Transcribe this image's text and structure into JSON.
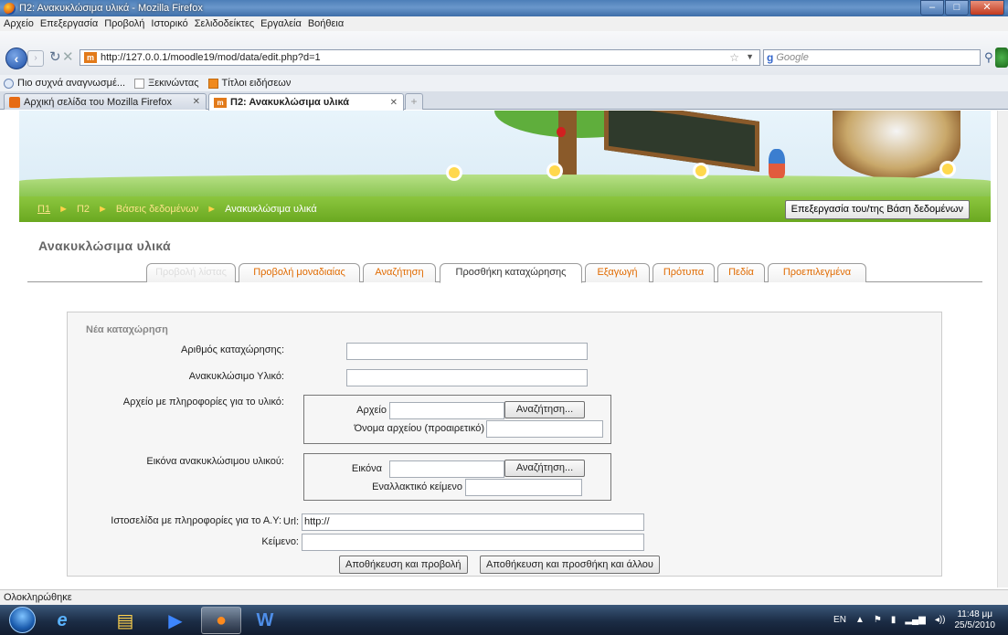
{
  "window": {
    "title": "Π2: Ανακυκλώσιμα υλικά - Mozilla Firefox",
    "controls": {
      "minimize": "–",
      "maximize": "□",
      "close": "✕"
    }
  },
  "menubar": [
    "Αρχείο",
    "Επεξεργασία",
    "Προβολή",
    "Ιστορικό",
    "Σελιδοδείκτες",
    "Εργαλεία",
    "Βοήθεια"
  ],
  "navbar": {
    "url": "http://127.0.0.1/moodle19/mod/data/edit.php?d=1",
    "search_placeholder": "Google",
    "search_engine": "g"
  },
  "bookmarks": [
    "Πιο συχνά αναγνωσμέ...",
    "Ξεκινώντας",
    "Τίτλοι ειδήσεων"
  ],
  "tabs": [
    {
      "label": "Αρχική σελίδα του Mozilla Firefox",
      "active": false
    },
    {
      "label": "Π2: Ανακυκλώσιμα υλικά",
      "active": true
    }
  ],
  "breadcrumb": {
    "items": [
      "Π1",
      "Π2",
      "Βάσεις δεδομένων"
    ],
    "current": "Ανακυκλώσιμα υλικά",
    "separator": "►"
  },
  "edit_db_button": "Επεξεργασία του/της Βάση δεδομένων",
  "page_title": "Ανακυκλώσιμα υλικά",
  "db_tabs": [
    {
      "label": "Προβολή λίστας",
      "selected": false,
      "faded": true
    },
    {
      "label": "Προβολή μοναδιαίας",
      "selected": false,
      "faded": false
    },
    {
      "label": "Αναζήτηση",
      "selected": false,
      "faded": false
    },
    {
      "label": "Προσθήκη καταχώρησης",
      "selected": true,
      "faded": false
    },
    {
      "label": "Εξαγωγή",
      "selected": false,
      "faded": false
    },
    {
      "label": "Πρότυπα",
      "selected": false,
      "faded": false
    },
    {
      "label": "Πεδία",
      "selected": false,
      "faded": false
    },
    {
      "label": "Προεπιλεγμένα",
      "selected": false,
      "faded": false
    }
  ],
  "form": {
    "legend": "Νέα καταχώρηση",
    "fields": {
      "entry_number": {
        "label": "Αριθμός καταχώρησης:",
        "value": ""
      },
      "recyclable": {
        "label": "Ανακυκλώσιμο Υλικό:",
        "value": ""
      },
      "file_info": {
        "label": "Αρχείο με πληροφορίες για το υλικό:",
        "file_label": "Αρχείο",
        "filename_label": "Όνομα αρχείου (προαιρετικό)",
        "browse": "Αναζήτηση..."
      },
      "image": {
        "label": "Εικόνα ανακυκλώσιμου υλικού:",
        "image_label": "Εικόνα",
        "alt_label": "Εναλλακτικό κείμενο",
        "browse": "Αναζήτηση..."
      },
      "website": {
        "label": "Ιστοσελίδα με πληροφορίες για το Α.Υ:",
        "url_label": "Url:",
        "url_value": "http://",
        "text_label": "Κείμενο:",
        "text_value": ""
      }
    },
    "buttons": {
      "save_view": "Αποθήκευση και προβολή",
      "save_add": "Αποθήκευση και προσθήκη και άλλου"
    }
  },
  "status": "Ολοκληρώθηκε",
  "taskbar": {
    "language": "EN",
    "time": "11:48 μμ",
    "date": "25/5/2010"
  }
}
